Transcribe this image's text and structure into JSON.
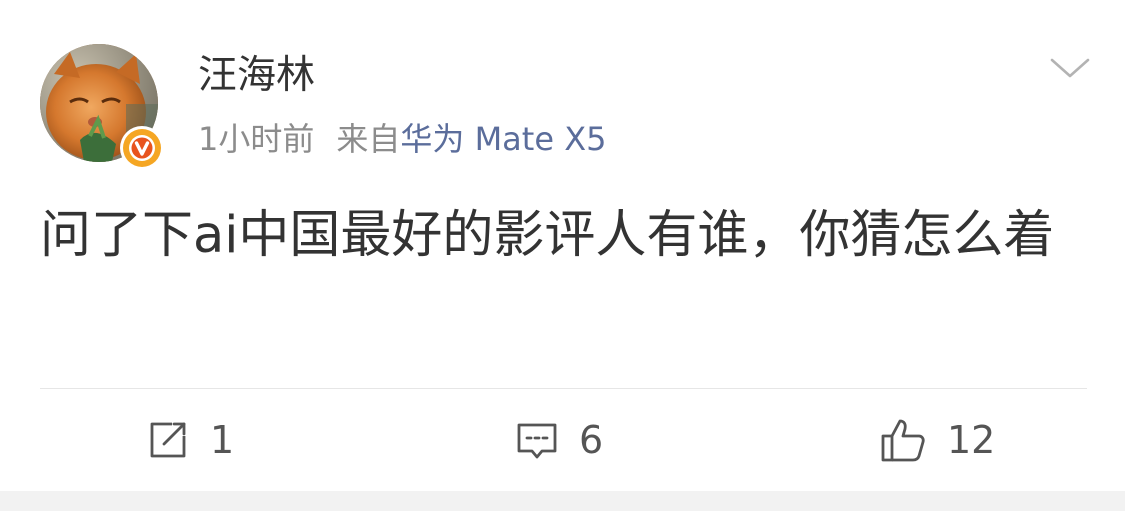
{
  "post": {
    "author": "汪海林",
    "time": "1小时前",
    "source_prefix": "来自",
    "source_device": "华为 Mate X5",
    "text": "问了下ai中国最好的影评人有谁，你猜怎么着"
  },
  "actions": {
    "repost_count": "1",
    "comment_count": "6",
    "like_count": "12"
  },
  "colors": {
    "text": "#333333",
    "meta": "#8c8c8c",
    "device_link": "#5b6d9b",
    "verified_badge": "#f5a623",
    "verified_badge_inner": "#e8541e",
    "divider": "#e6e6e6"
  },
  "icons": {
    "menu": "chevron-down-icon",
    "verified": "verified-v-icon",
    "repost": "repost-icon",
    "comment": "comment-icon",
    "like": "thumbs-up-icon"
  }
}
